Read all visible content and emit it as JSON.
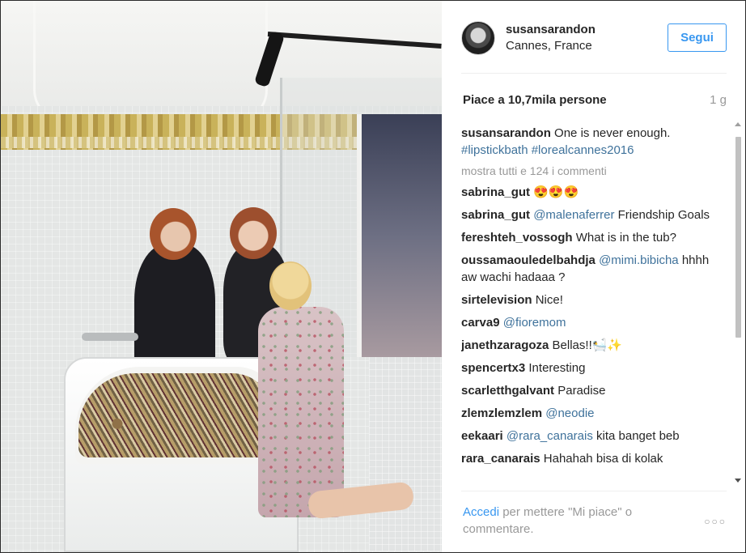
{
  "post": {
    "username": "susansarandon",
    "location": "Cannes, France",
    "follow_label": "Segui",
    "likes": "Piace a 10,7mila persone",
    "time": "1 g"
  },
  "comments": {
    "caption": {
      "user": "susansarandon",
      "text": "One is never enough.",
      "hashtags": "#lipstickbath #lorealcannes2016"
    },
    "show_all": "mostra tutti e 124 i commenti",
    "items": [
      {
        "user": "sabrina_gut",
        "text": "😍😍😍",
        "mention": ""
      },
      {
        "user": "sabrina_gut",
        "mention": "@malenaferrer",
        "text": "Friendship Goals"
      },
      {
        "user": "fereshteh_vossogh",
        "mention": "",
        "text": "What is in the tub?"
      },
      {
        "user": "oussamaouledelbahdja",
        "mention": "@mimi.bibicha",
        "text": "hhhh aw wachi hadaaa ?"
      },
      {
        "user": "sirtelevision",
        "mention": "",
        "text": "Nice!"
      },
      {
        "user": "carva9",
        "mention": "@fioremom",
        "text": ""
      },
      {
        "user": "janethzaragoza",
        "mention": "",
        "text": "Bellas!!🛀✨"
      },
      {
        "user": "spencertx3",
        "mention": "",
        "text": "Interesting"
      },
      {
        "user": "scarletthgalvant",
        "mention": "",
        "text": "Paradise"
      },
      {
        "user": "zlemzlemzlem",
        "mention": "@neodie",
        "text": ""
      },
      {
        "user": "eekaari",
        "mention": "@rara_canarais",
        "text": "kita banget beb"
      },
      {
        "user": "rara_canarais",
        "mention": "",
        "text": "Hahahah bisa di kolak"
      }
    ]
  },
  "footer": {
    "login": "Accedi",
    "text": "per mettere \"Mi piace\" o commentare.",
    "options_icon": "more-options-icon",
    "options_glyph": "○○○"
  },
  "colors": {
    "link": "#3f729b",
    "accent": "#3897f0",
    "muted": "#999999"
  }
}
